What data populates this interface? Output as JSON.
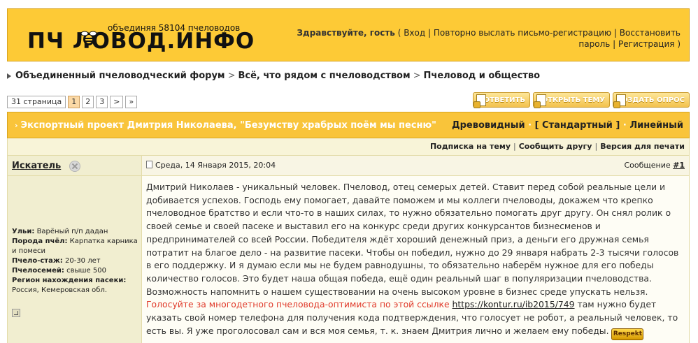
{
  "header": {
    "tagline": "объединяя 58104 пчеловодов",
    "logo_text": "ПЧ   ЛОВОД.ИНФО",
    "greeting": "Здравствуйте, гость",
    "links": [
      "Вход",
      "Повторно выслать письмо-регистрацию",
      "Восстановить пароль",
      "Регистрация"
    ]
  },
  "breadcrumb": [
    "Объединенный пчеловодческий форум",
    "Всё, что рядом с пчеловодством",
    "Пчеловод и общество"
  ],
  "pagination": {
    "total": "31 страница",
    "pages": [
      "1",
      "2",
      "3",
      ">",
      "»"
    ],
    "current": "1"
  },
  "actions": {
    "reply": "ответить",
    "new_topic": "открыть тему",
    "new_poll": "создать опрос"
  },
  "topic": {
    "title": "Экспортный проект Дмитрия Николаева, \"Безумству храбрых поём мы песню\"",
    "modes": [
      "Древовидный",
      "[ Стандартный ]",
      "Линейный"
    ]
  },
  "options": [
    "Подписка на тему",
    "Сообщить другу",
    "Версия для печати"
  ],
  "post": {
    "author": "Искатель",
    "date": "Среда, 14 Января 2015, 20:04",
    "number_label": "Сообщение",
    "number": "#1",
    "info": [
      {
        "k": "Ульи:",
        "v": "Варёный п/п дадан"
      },
      {
        "k": "Порода пчёл:",
        "v": "Карпатка карника и помеси"
      },
      {
        "k": "Пчело-стаж:",
        "v": "20-30 лет"
      },
      {
        "k": "Пчелосемей:",
        "v": "свыше 500"
      },
      {
        "k": "Регион нахождения пасеки:",
        "v": "Россия, Кемеровская обл."
      }
    ],
    "body_1": "Дмитрий Николаев - уникальный человек. Пчеловод, отец семерых детей. Ставит перед собой реальные цели и добивается успехов. Господь ему помогает, давайте поможем и мы коллеги пчеловоды, докажем что крепко пчеловодное братство и если что-то в наших силах, то нужно обязательно помогать друг другу. Он снял ролик о своей семье и своей пасеке и выставил его на конкурс среди других конкурсантов бизнесменов и предпринимателей со всей России. Победителя ждёт хороший денежный приз, а деньги его дружная семья потратит на благое дело - на развитие пасеки. Чтобы он победил, нужно до 29 января набрать 2-3 тысячи голосов в его поддержку. И я думаю если мы не будем равнодушны, то обязательно наберём нужное для его победы количество голосов. Это будет наша общая победа, ещё один реальный шаг в популяризации пчеловодства. Возможность напомнить о нашем существовании на очень высоком уровне в бизнес среде упускать нельзя. ",
    "body_red": "Голосуйте за многодетного пчеловода-оптимиста по этой ссылке",
    "body_link": "https://kontur.ru/ib2015/749",
    "body_2": " там нужно будет указать свой номер телефона для получения кода подтверждения, что голосует не робот, а реальный человек, то есть вы. Я уже проголосовал сам и вся моя семья, т. к. знаем Дмитрия лично и желаем ему победы. ",
    "smiley": "Respekt"
  }
}
